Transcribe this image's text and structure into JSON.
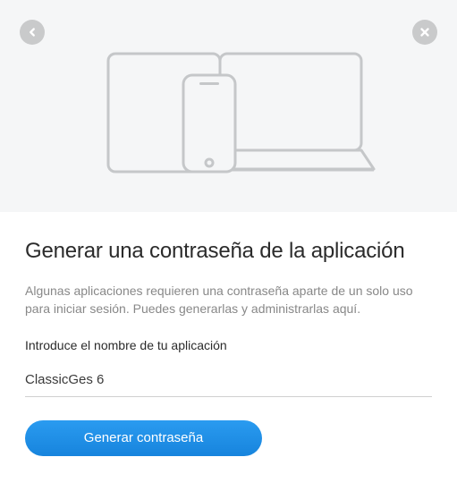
{
  "page": {
    "title": "Generar una contraseña de la aplicación",
    "description": "Algunas aplicaciones requieren una contraseña aparte de un solo uso para iniciar sesión. Puedes generarlas y administrarlas aquí.",
    "fieldLabel": "Introduce el nombre de tu aplicación",
    "fieldValue": "ClassicGes 6",
    "buttonLabel": "Generar contraseña"
  }
}
